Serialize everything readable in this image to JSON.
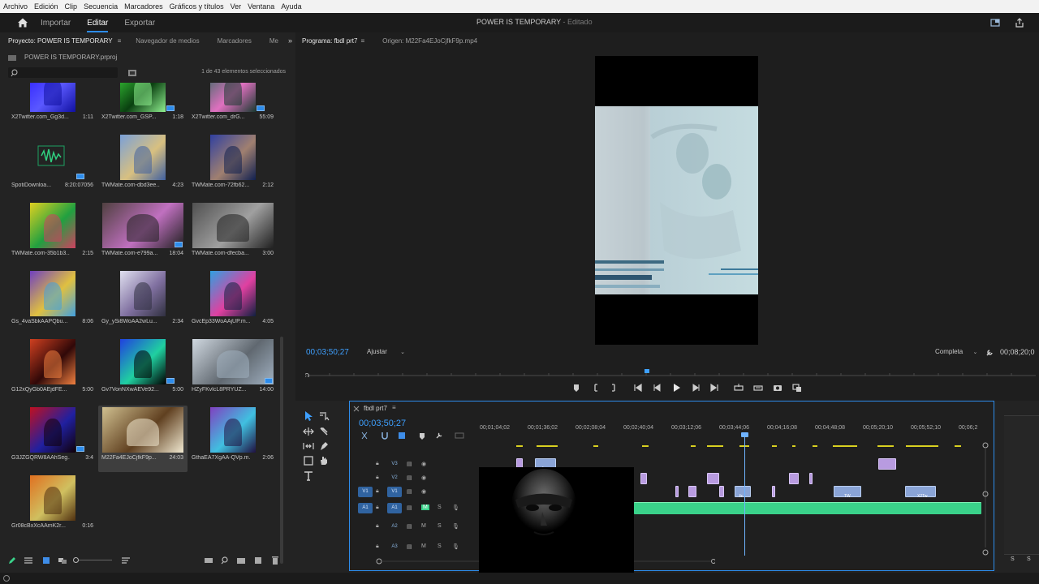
{
  "menu": [
    "Archivo",
    "Edición",
    "Clip",
    "Secuencia",
    "Marcadores",
    "Gráficos y títulos",
    "Ver",
    "Ventana",
    "Ayuda"
  ],
  "header": {
    "workspaces": [
      "Importar",
      "Editar",
      "Exportar"
    ],
    "active_workspace": "Editar",
    "project_title": "POWER IS TEMPORARY",
    "edited_suffix": "- Editado"
  },
  "project_panel": {
    "tabs": [
      "Proyecto: POWER IS TEMPORARY",
      "Navegador de medios",
      "Marcadores",
      "Me"
    ],
    "file": "POWER IS TEMPORARY.prproj",
    "selection_count": "1 de 43 elementos seleccionados",
    "items": [
      {
        "name": "X2Twitter.com_Gg3d...",
        "duration": "1:11",
        "colors": [
          "#2a1cff",
          "#5a58ff",
          "#1010a0"
        ],
        "badge": false
      },
      {
        "name": "X2Twitter.com_GSP...",
        "duration": "1:18",
        "colors": [
          "#3ad23a",
          "#0a4010",
          "#90f090"
        ],
        "badge": true
      },
      {
        "name": "X2Twitter.com_drG...",
        "duration": "55:09",
        "colors": [
          "#2a6a5a",
          "#e070c0",
          "#1a3a30"
        ],
        "badge": true
      },
      {
        "name": "SpotiDownloa...",
        "duration": "8:20:07056",
        "colors": [
          "#1ea060",
          "#0a5030",
          "#30d080"
        ],
        "badge": true,
        "audio": true
      },
      {
        "name": "TWMate.com-dbd3ee...",
        "duration": "4:23",
        "colors": [
          "#7aa0d8",
          "#d8c080",
          "#4060a0"
        ],
        "badge": false
      },
      {
        "name": "TWMate.com-72fb62...",
        "duration": "2:12",
        "colors": [
          "#3040a0",
          "#a08070",
          "#102050"
        ],
        "badge": false
      },
      {
        "name": "TWMate.com-35b1b3...",
        "duration": "2:15",
        "colors": [
          "#e0d020",
          "#20a040",
          "#d04060"
        ],
        "badge": false
      },
      {
        "name": "TWMate.com-e799a...",
        "duration": "18:04",
        "colors": [
          "#504040",
          "#c070c0",
          "#202020"
        ],
        "badge": true,
        "wide": true
      },
      {
        "name": "TWMate.com-dfecba...",
        "duration": "3:00",
        "colors": [
          "#505050",
          "#a0a0a0",
          "#202020"
        ],
        "badge": false,
        "wide": true
      },
      {
        "name": "Gs_4vaSbkAAPQbu...",
        "duration": "8:06",
        "colors": [
          "#7040c0",
          "#e0c040",
          "#40a0e0"
        ],
        "badge": false
      },
      {
        "name": "Gy_ySi8WoAA2wLu...",
        "duration": "2:34",
        "colors": [
          "#e0e0f0",
          "#8070a0",
          "#303040"
        ],
        "badge": false
      },
      {
        "name": "GvcEp33WoAAjUP.m...",
        "duration": "4:05",
        "colors": [
          "#30a0e0",
          "#e040a0",
          "#102040"
        ],
        "badge": false
      },
      {
        "name": "G12xQyGb0AEjdFE...",
        "duration": "5:00",
        "colors": [
          "#d04020",
          "#300808",
          "#f08040"
        ],
        "badge": false
      },
      {
        "name": "Gv7VonNXwAEVe92...",
        "duration": "5:00",
        "colors": [
          "#2040e0",
          "#20d0a0",
          "#000000"
        ],
        "badge": true
      },
      {
        "name": "HZyFKvlcL8PRYUZ...",
        "duration": "14:00",
        "colors": [
          "#d0d8e0",
          "#606870",
          "#a0b0c0"
        ],
        "badge": true,
        "wide": true
      },
      {
        "name": "G3JZGQRW8AAhSeg...",
        "duration": "3:4",
        "colors": [
          "#c01020",
          "#2020a0",
          "#100008"
        ],
        "badge": true
      },
      {
        "name": "M22Fa4EJoCjfkF9p...",
        "duration": "24:03",
        "colors": [
          "#d0c090",
          "#604020",
          "#f0e8d0"
        ],
        "badge": false,
        "wide": true,
        "selected": true
      },
      {
        "name": "GthaEA7XgAA-QVp.m...",
        "duration": "2:06",
        "colors": [
          "#8040c0",
          "#40c0e0",
          "#201040"
        ],
        "badge": false
      },
      {
        "name": "Gr08cBxXcAAmK2r...",
        "duration": "0:16",
        "colors": [
          "#e07020",
          "#d0c060",
          "#503010"
        ],
        "badge": false
      }
    ]
  },
  "program_monitor": {
    "tabs": [
      "Programa: fbdl prt7",
      "Origen: M22Fa4EJoCjfkF9p.mp4"
    ],
    "timecode": "00;03;50;27",
    "fit": "Ajustar",
    "quality": "Completa",
    "duration": "00;08;20;0"
  },
  "timeline": {
    "sequence": "fbdl prt7",
    "timecode": "00;03;50;27",
    "ticks": [
      "00;01;04;02",
      "00;01;36;02",
      "00;02;08;04",
      "00;02;40;04",
      "00;03;12;06",
      "00;03;44;06",
      "00;04;16;08",
      "00;04;48;08",
      "00;05;20;10",
      "00;05;52;10",
      "00;06;2"
    ],
    "tracks": [
      {
        "id": "V3",
        "target": "",
        "kind": "video"
      },
      {
        "id": "V2",
        "target": "",
        "kind": "video"
      },
      {
        "id": "V1",
        "target": "V1",
        "kind": "video"
      },
      {
        "id": "A1",
        "target": "A1",
        "kind": "audio"
      },
      {
        "id": "A2",
        "target": "",
        "kind": "audio"
      },
      {
        "id": "A3",
        "target": "",
        "kind": "audio"
      }
    ],
    "track_toggles": {
      "mute": "M",
      "solo": "S"
    },
    "clip_labels": [
      "fx",
      "TW",
      "X2Tw"
    ]
  },
  "status": {
    "right_labels": [
      "S",
      "S"
    ]
  }
}
